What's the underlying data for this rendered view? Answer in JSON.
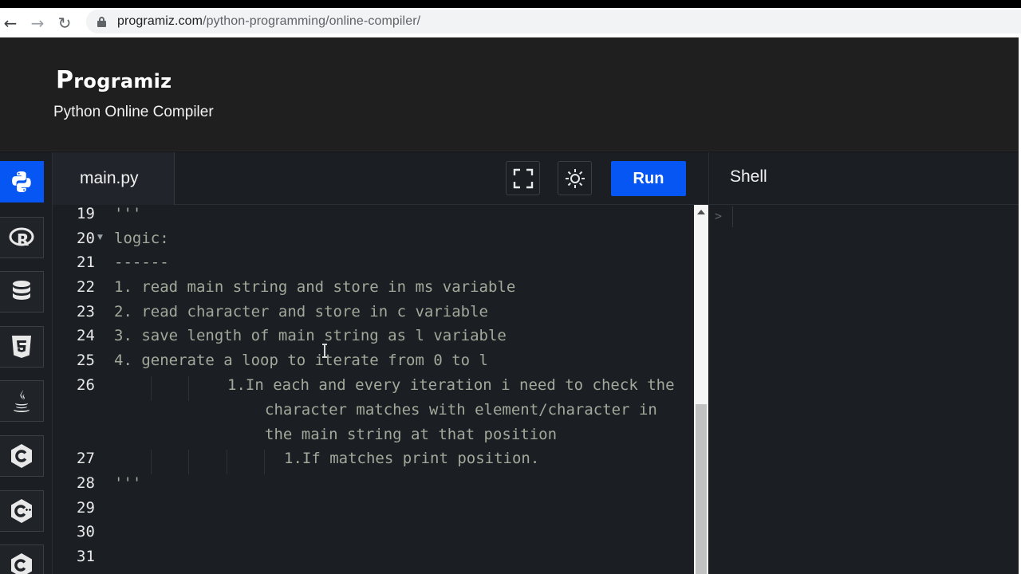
{
  "browser": {
    "url_domain": "programiz.com",
    "url_path": "/python-programming/online-compiler/"
  },
  "header": {
    "logo_first": "P",
    "logo_rest": "rogramiz",
    "subtitle": "Python Online Compiler"
  },
  "sidebar": {
    "items": [
      {
        "name": "python-icon",
        "active": true
      },
      {
        "name": "r-icon"
      },
      {
        "name": "database-icon"
      },
      {
        "name": "html5-icon"
      },
      {
        "name": "java-icon"
      },
      {
        "name": "c-icon"
      },
      {
        "name": "cpp-icon"
      },
      {
        "name": "csharp-icon"
      }
    ]
  },
  "editor": {
    "tab_label": "main.py",
    "fullscreen_icon": "fullscreen-icon",
    "theme_icon": "sun-icon",
    "run_label": "Run",
    "lines": [
      {
        "num": "19",
        "text": "'''"
      },
      {
        "num": "20",
        "text": "logic:"
      },
      {
        "num": "21",
        "text": "------"
      },
      {
        "num": "22",
        "text": "1. read main string and store in ms variable"
      },
      {
        "num": "23",
        "text": "2. read character and store in c variable"
      },
      {
        "num": "24",
        "text": "3. save length of main string as l variable"
      },
      {
        "num": "25",
        "text": "4. generate a loop to iterate from 0 to l"
      },
      {
        "num": "26",
        "text": "1.In each and every iteration i need to check the"
      },
      {
        "num": "",
        "text": "character matches with element/character in"
      },
      {
        "num": "",
        "text": "the main string at that position"
      },
      {
        "num": "27",
        "text": "1.If matches print position."
      },
      {
        "num": "28",
        "text": "'''"
      },
      {
        "num": "29",
        "text": ""
      },
      {
        "num": "30",
        "text": ""
      },
      {
        "num": "31",
        "text": ""
      }
    ]
  },
  "shell": {
    "title": "Shell",
    "prompt": ">"
  },
  "colors": {
    "accent": "#0556f3",
    "background": "#1b1f24",
    "header": "#1f1f1f",
    "code_text": "#a3a89a"
  }
}
